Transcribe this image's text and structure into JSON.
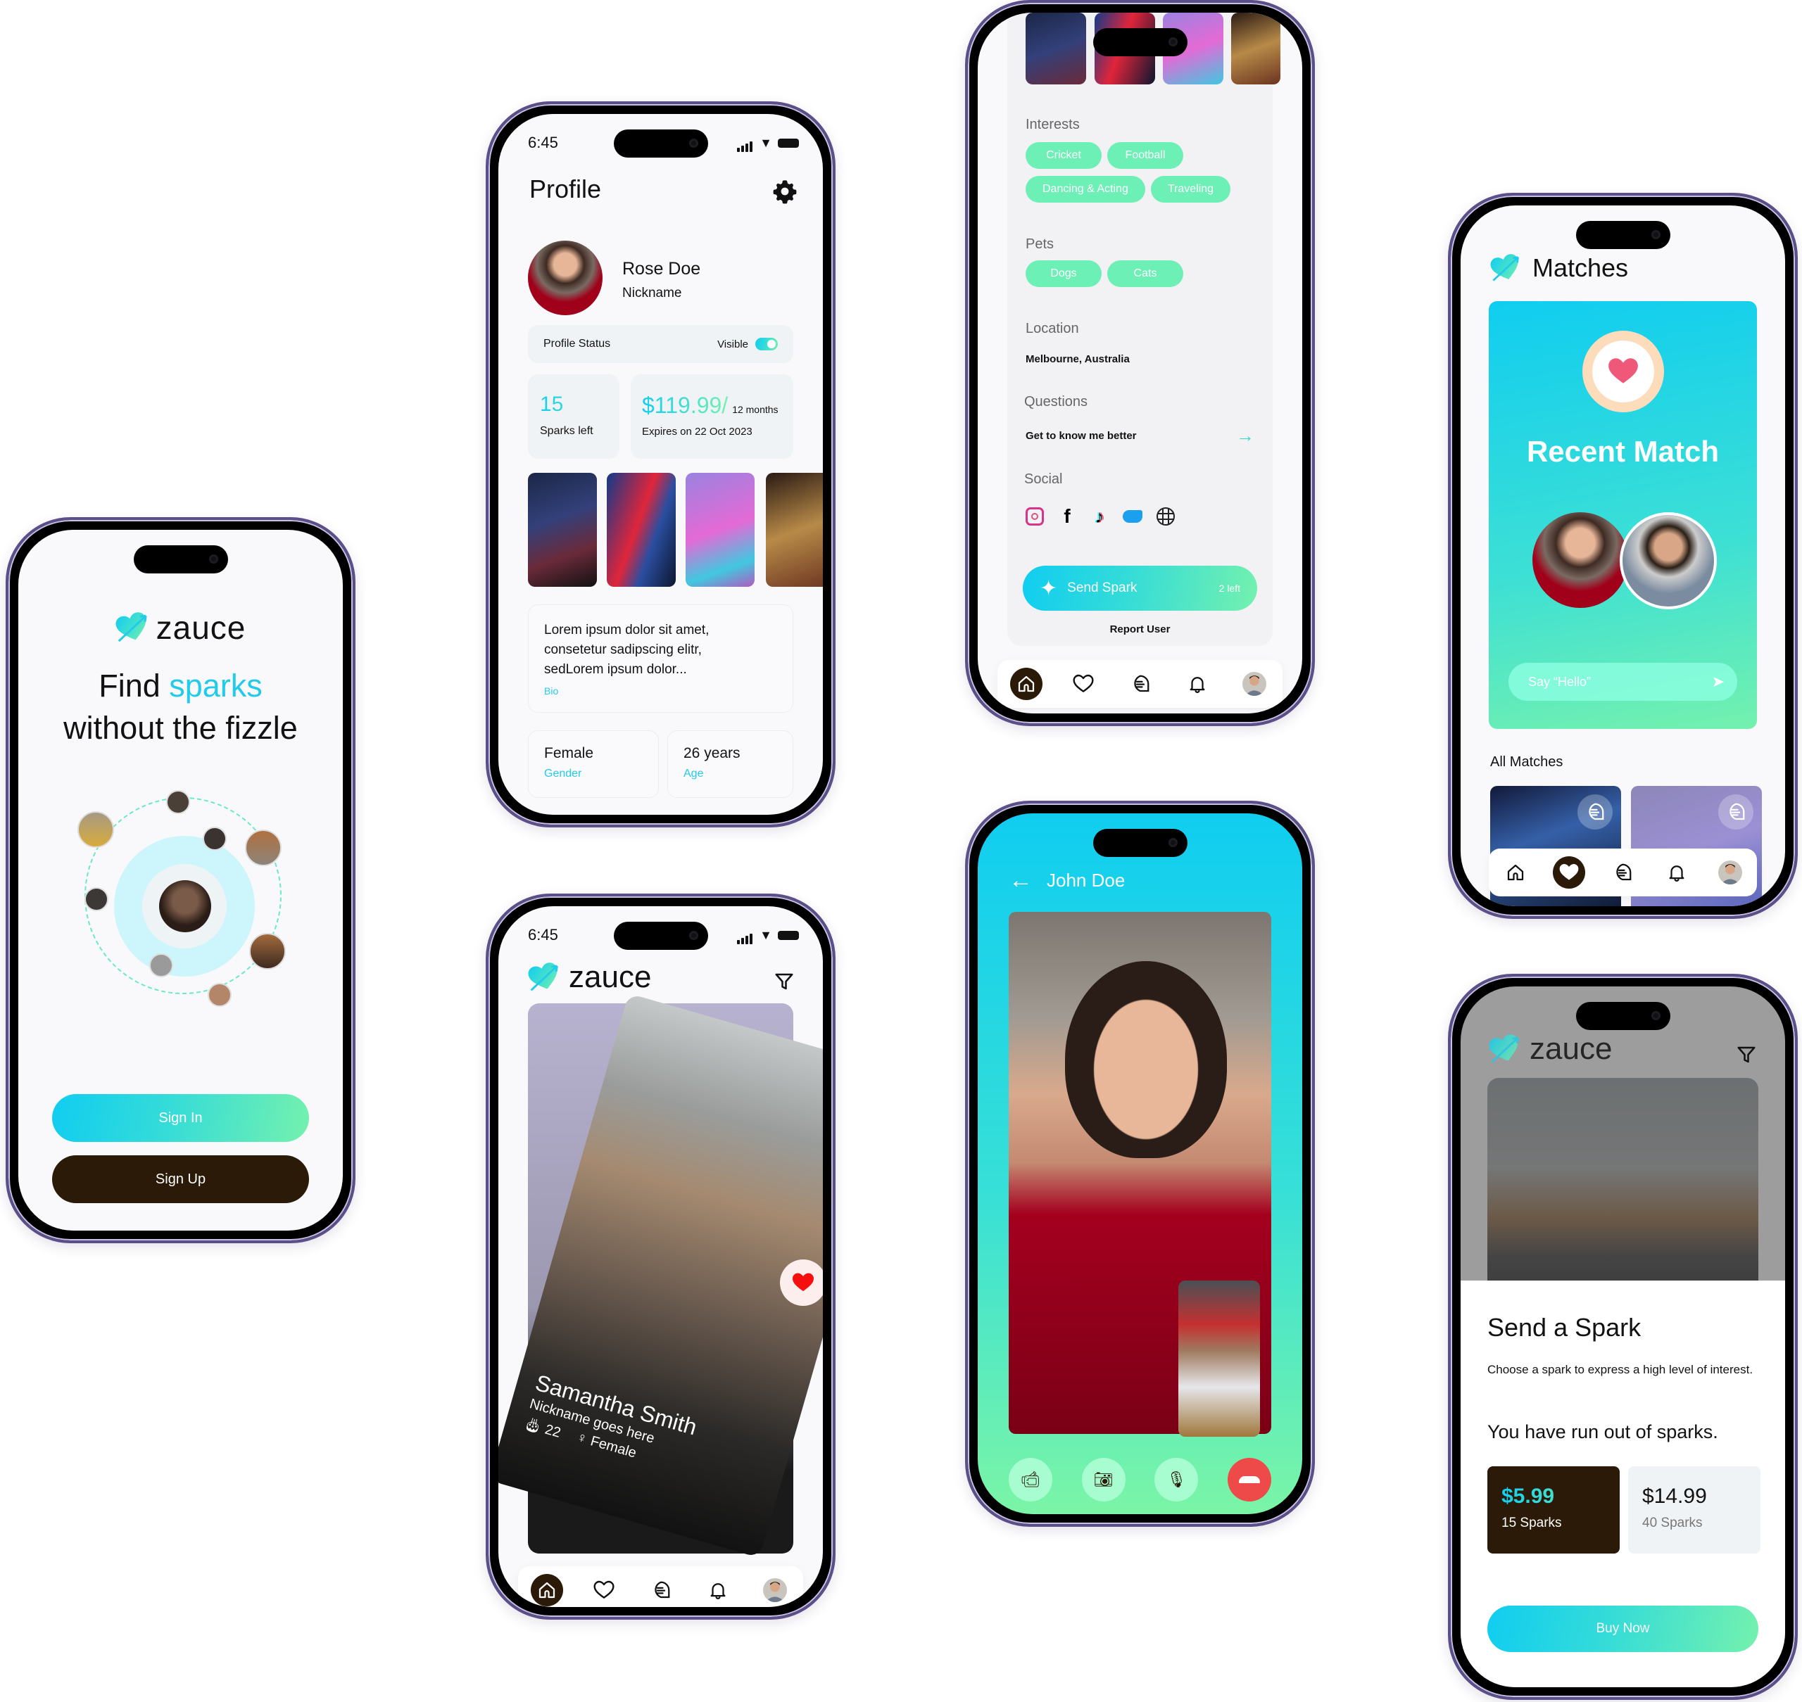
{
  "brand": {
    "name": "zauce",
    "colors": {
      "primary_cyan": "#10cdf0",
      "primary_green": "#74f1ae",
      "dark_brown": "#2b1a07",
      "chip_green": "#6cf0b6",
      "danger_red": "#ef4a4a"
    }
  },
  "status_bar": {
    "time": "6:45"
  },
  "welcome_screen": {
    "logo_text": "zauce",
    "headline_line1_plain": "Find ",
    "headline_line1_accent": "sparks",
    "headline_line2": "without the fizzle",
    "sign_in_label": "Sign In",
    "sign_up_label": "Sign Up"
  },
  "profile_screen": {
    "title": "Profile",
    "name": "Rose Doe",
    "nickname": "Nickname",
    "status_label": "Profile Status",
    "visibility_label": "Visible",
    "visibility_on": true,
    "sparks_count": "15",
    "sparks_label": "Sparks left",
    "price": "$119.99/",
    "price_period": "12 months",
    "expiry": "Expires on 22 Oct 2023",
    "bio_text": "Lorem ipsum dolor sit amet, consetetur sadipscing elitr, sedLorem ipsum dolor...",
    "bio_label": "Bio",
    "gender_value": "Female",
    "gender_label": "Gender",
    "age_value": "26 years",
    "age_label": "Age"
  },
  "detail_screen": {
    "interests_title": "Interests",
    "interests": [
      "Cricket",
      "Football",
      "Dancing & Acting",
      "Traveling"
    ],
    "pets_title": "Pets",
    "pets": [
      "Dogs",
      "Cats"
    ],
    "location_title": "Location",
    "location_value": "Melbourne, Australia",
    "questions_title": "Questions",
    "question_link": "Get to know me better",
    "social_title": "Social",
    "social_icons": [
      "instagram-icon",
      "facebook-icon",
      "tiktok-icon",
      "onlyfans-icon",
      "globe-icon"
    ],
    "send_spark_label": "Send Spark",
    "send_spark_remaining": "2 left",
    "report_label": "Report User"
  },
  "matches_screen": {
    "title": "Matches",
    "recent_match_title": "Recent Match",
    "message_placeholder": "Say “Hello”",
    "all_matches_title": "All Matches"
  },
  "swipe_screen": {
    "logo_text": "zauce",
    "card_name": "Samantha Smith",
    "card_nickname": "Nickname goes here",
    "card_age": "22",
    "card_gender": "Female"
  },
  "video_call_screen": {
    "contact_name": "John Doe",
    "controls": [
      "video-off",
      "switch-camera",
      "mute-mic",
      "end-call"
    ]
  },
  "spark_purchase_screen": {
    "logo_text": "zauce",
    "title": "Send a Spark",
    "description": "Choose a spark to express a high level of interest.",
    "out_of_sparks": "You have run out of sparks.",
    "packages": [
      {
        "price": "$5.99",
        "sparks": "15 Sparks",
        "selected": true
      },
      {
        "price": "$14.99",
        "sparks": "40 Sparks",
        "selected": false
      }
    ],
    "buy_label": "Buy Now"
  },
  "bottom_nav": [
    "home",
    "matches",
    "chat",
    "notifications",
    "profile"
  ]
}
